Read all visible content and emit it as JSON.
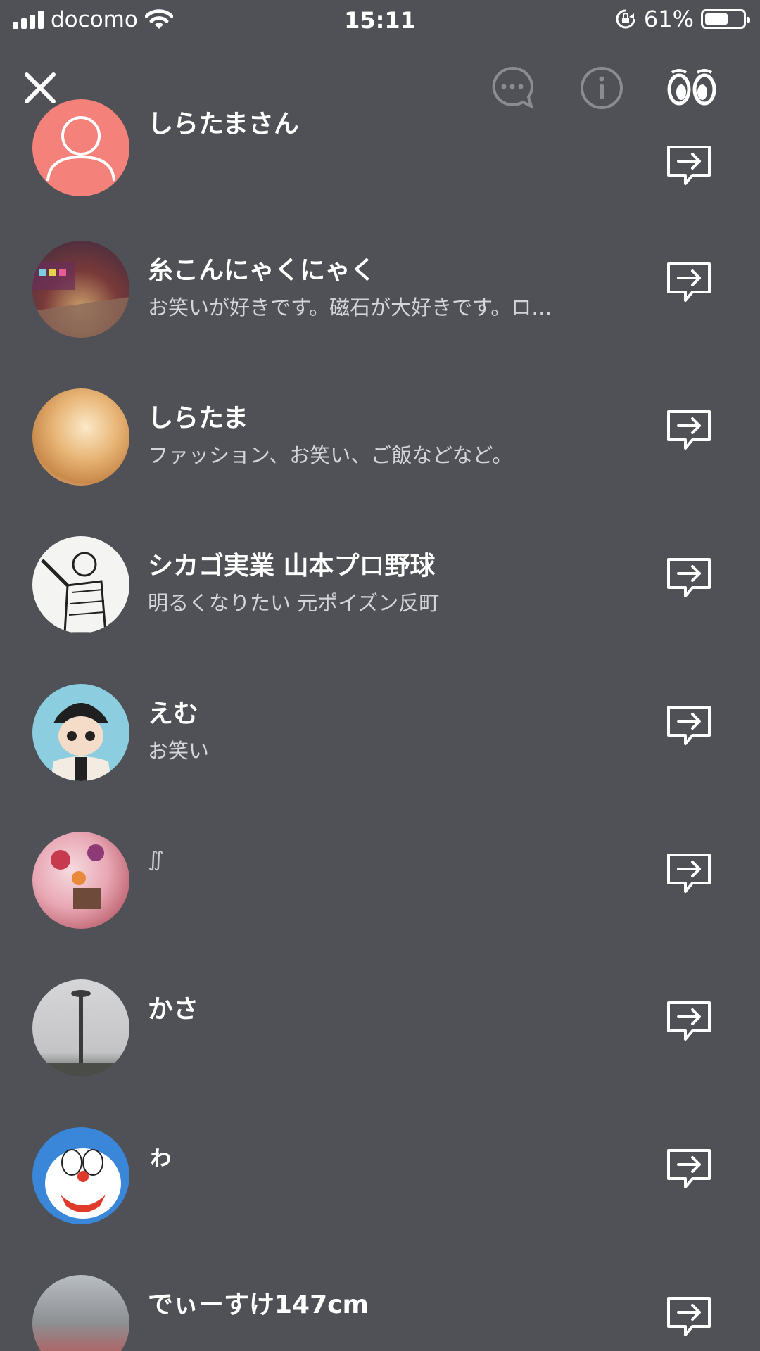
{
  "status_bar": {
    "carrier": "docomo",
    "time": "15:11",
    "battery_percent": "61%",
    "battery_level": 0.61
  },
  "toolbar": {
    "close_icon": "close-icon",
    "chat_icon": "chat-bubble-icon",
    "info_icon": "info-icon",
    "follow_icon": "eyes-icon"
  },
  "users": [
    {
      "name": "しらたまさん",
      "bio": "",
      "avatar": "default-avatar"
    },
    {
      "name": "糸こんにゃくにゃく",
      "bio": "お笑いが好きです。磁石が大好きです。ロ…",
      "avatar": "photo"
    },
    {
      "name": "しらたま",
      "bio": "ファッション、お笑い、ご飯などなど。",
      "avatar": "photo"
    },
    {
      "name": "シカゴ実業 山本プロ野球",
      "bio": "明るくなりたい 元ポイズン反町",
      "avatar": "illustration"
    },
    {
      "name": "えむ",
      "bio": "お笑い",
      "avatar": "illustration"
    },
    {
      "name": "",
      "bio": "∬",
      "avatar": "photo"
    },
    {
      "name": "かさ",
      "bio": "",
      "avatar": "photo"
    },
    {
      "name": "ゎ",
      "bio": "",
      "avatar": "illustration"
    },
    {
      "name": "でぃーすけ147cm",
      "bio": "",
      "avatar": "photo"
    }
  ],
  "colors": {
    "background": "#4f5156",
    "text": "#ffffff",
    "subtext": "#d4d5d8",
    "default_avatar": "#f4817a"
  }
}
